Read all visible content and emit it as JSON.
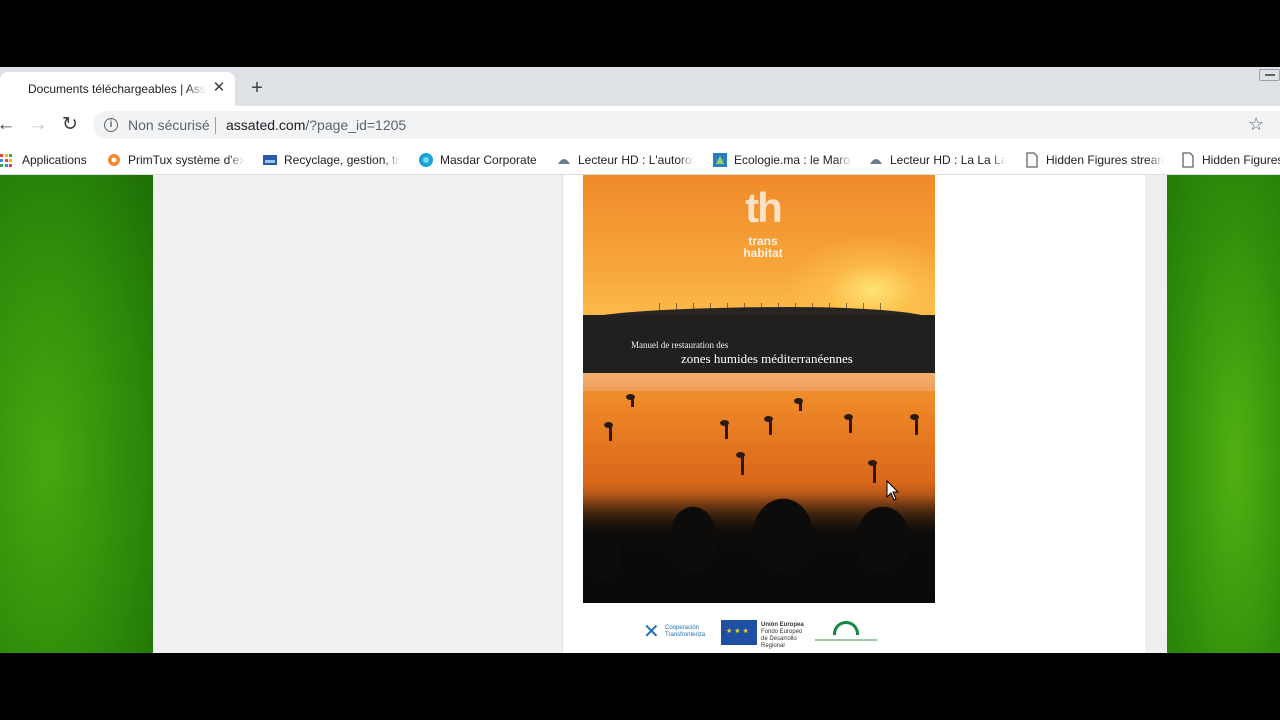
{
  "browser": {
    "tab": {
      "title": "Documents téléchargeables | Assated",
      "close_label": "✕"
    },
    "new_tab_label": "+",
    "toolbar": {
      "back_label": "←",
      "forward_label": "→",
      "reload_label": "↻",
      "security_label": "Non sécurisé",
      "url_domain": "assated.com",
      "url_rest": "/?page_id=1205",
      "star_label": "☆",
      "info_icon_label": "i"
    },
    "bookmarks": [
      {
        "label": "Applications",
        "icon": "apps-grid-icon"
      },
      {
        "label": "PrimTux système d'exploitation",
        "icon": "primtux-icon"
      },
      {
        "label": "Recyclage, gestion, traitement",
        "icon": "recycling-site-icon"
      },
      {
        "label": "Masdar Corporate",
        "icon": "masdar-icon"
      },
      {
        "label": "Lecteur HD : L'autoroute",
        "icon": "video-player-icon"
      },
      {
        "label": "Ecologie.ma : le Maroc",
        "icon": "ecologie-icon"
      },
      {
        "label": "Lecteur HD : La La Land",
        "icon": "video-player-icon"
      },
      {
        "label": "Hidden Figures streaming",
        "icon": "page-icon"
      },
      {
        "label": "Hidden Figures",
        "icon": "page-icon"
      }
    ]
  },
  "document": {
    "cover": {
      "brand_mark": "th",
      "brand_name_line1": "trans",
      "brand_name_line2": "habitat",
      "subtitle": "Manuel de restauration des",
      "title": "zones humides méditerranéennes"
    },
    "logos": {
      "cooperation_line1": "Cooperación",
      "cooperation_line2": "Transfronteriza",
      "eu_line1": "Unión Europea",
      "eu_line2": "Fondo Europeo de Desarrollo Regional"
    }
  },
  "colors": {
    "tabstrip": "#dee1e6",
    "page_background_green": "#3a9b0e",
    "cover_orange": "#f08a2a",
    "eu_blue": "#1e4fa3",
    "junta_green": "#0c8b3d"
  }
}
